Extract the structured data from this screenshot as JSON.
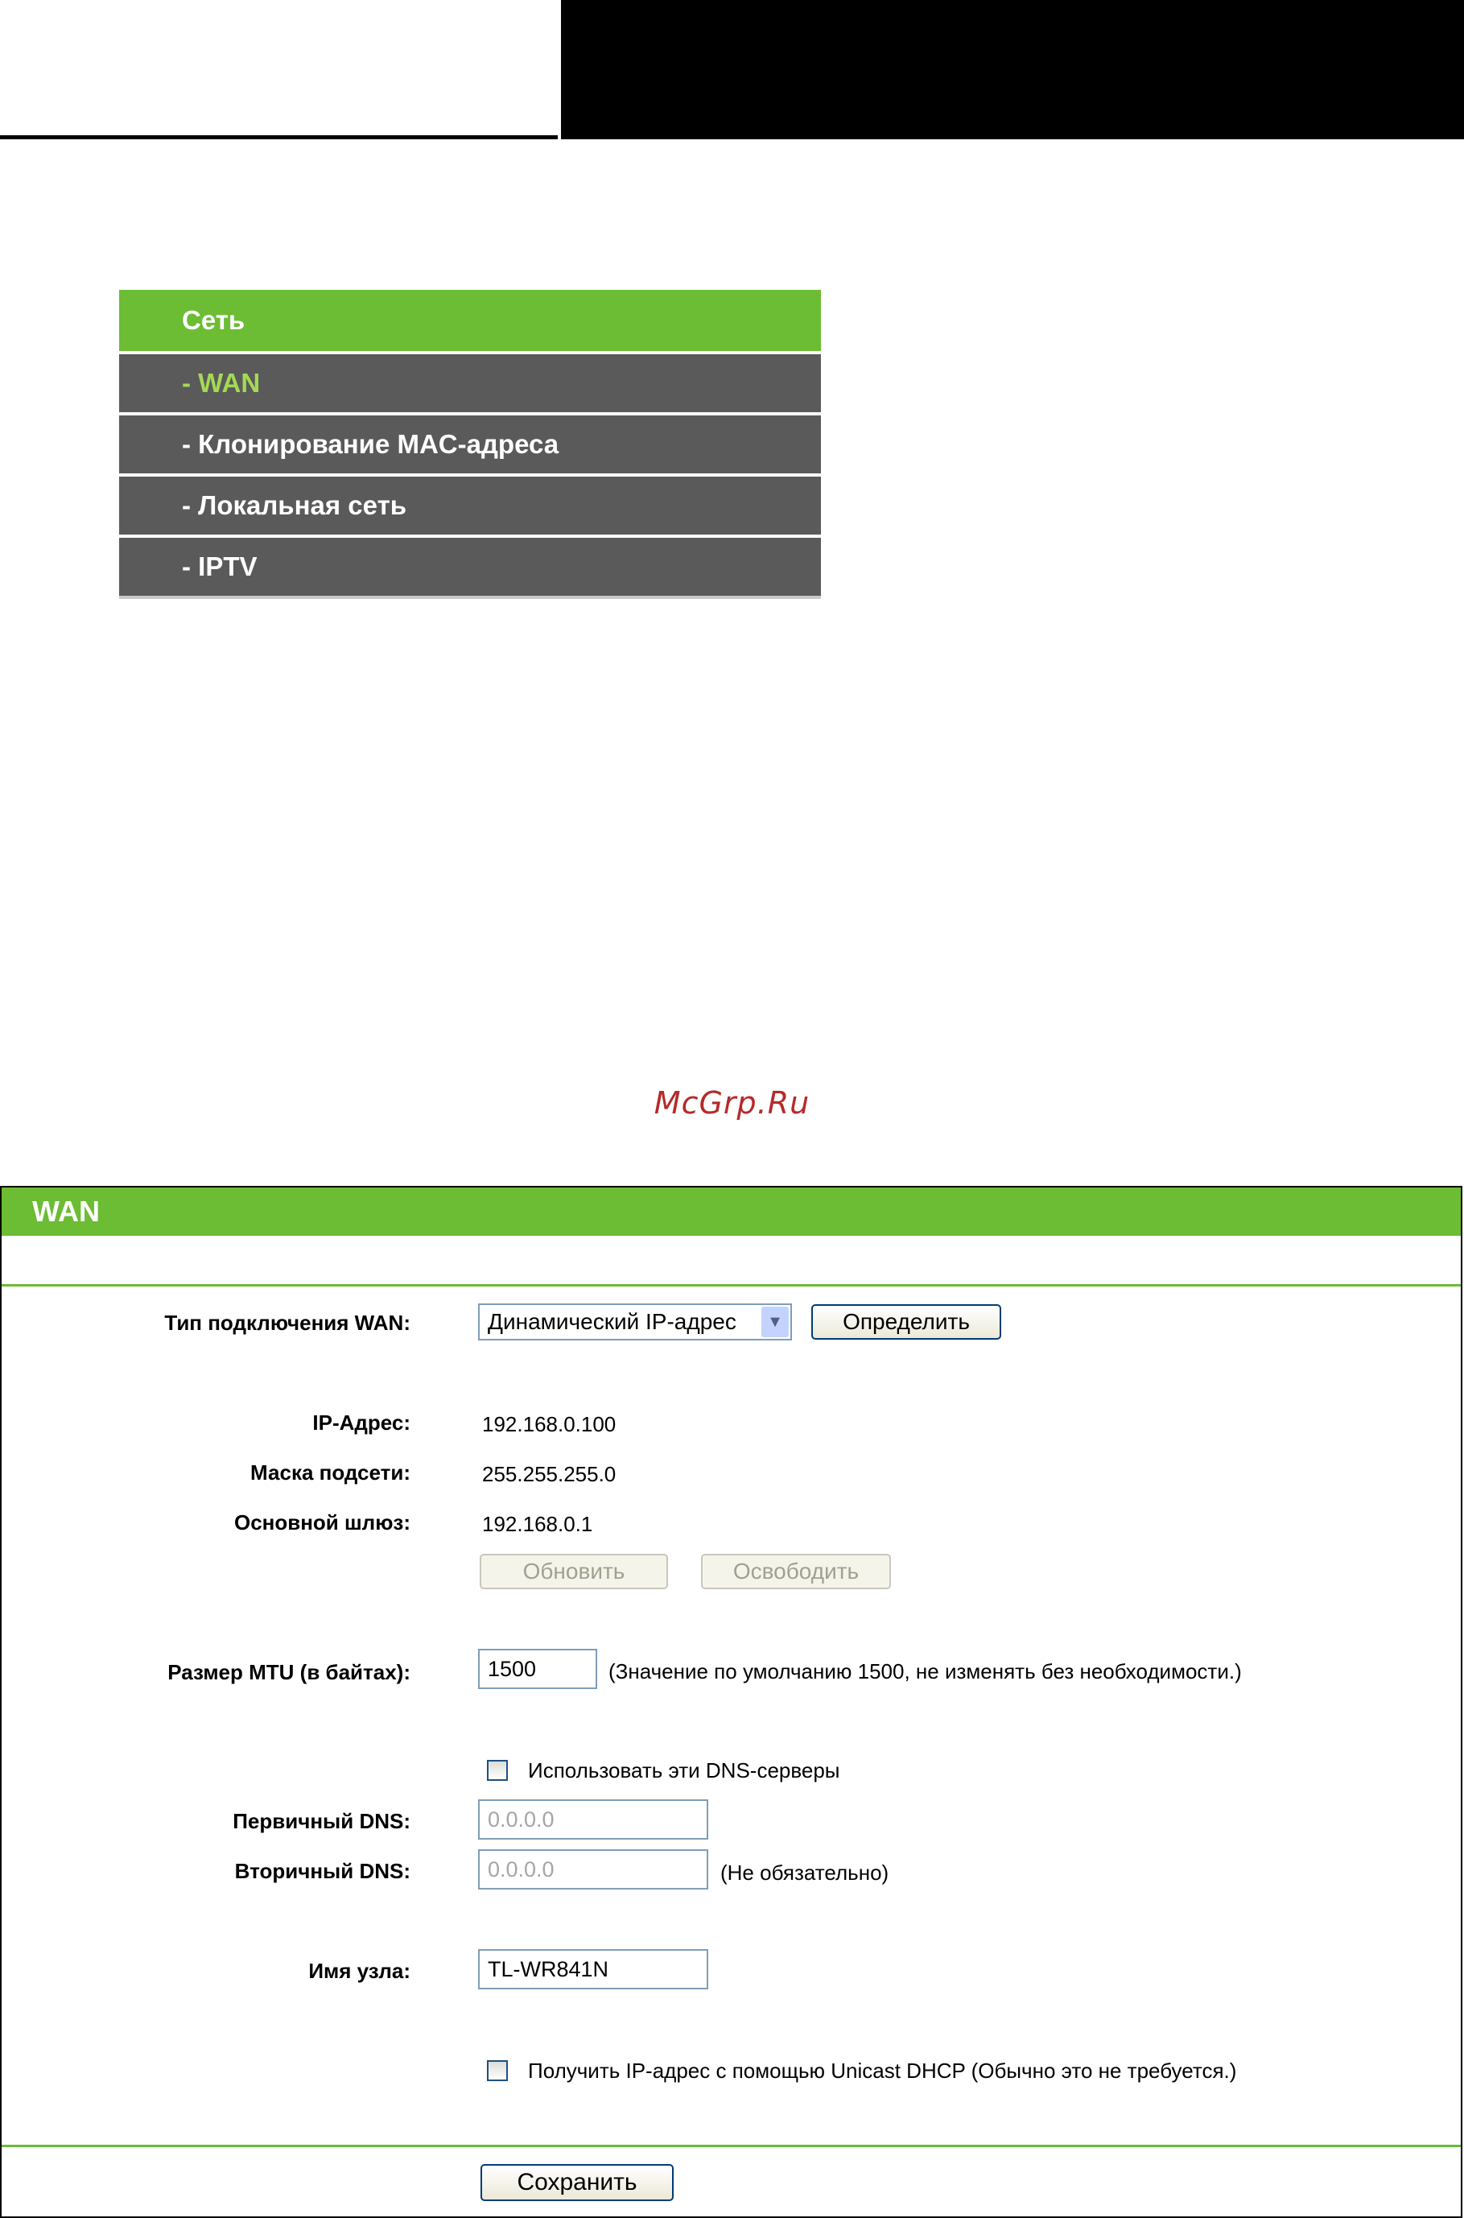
{
  "nav": {
    "header": "Сеть",
    "items": [
      "- WAN",
      "- Клонирование MAC-адреса",
      "- Локальная сеть",
      "- IPTV"
    ]
  },
  "watermark": "McGrp.Ru",
  "panel": {
    "title": "WAN",
    "wan_type_label": "Тип подключения WAN:",
    "wan_type_value": "Динамический IP-адрес",
    "detect_button": "Определить",
    "ip_label": "IP-Адрес:",
    "ip_value": "192.168.0.100",
    "mask_label": "Маска подсети:",
    "mask_value": "255.255.255.0",
    "gateway_label": "Основной шлюз:",
    "gateway_value": "192.168.0.1",
    "renew_button": "Обновить",
    "release_button": "Освободить",
    "mtu_label": "Размер MTU (в байтах):",
    "mtu_value": "1500",
    "mtu_note": "(Значение по умолчанию 1500, не изменять без необходимости.)",
    "use_dns_label": "Использовать эти DNS-серверы",
    "primary_dns_label": "Первичный DNS:",
    "primary_dns_placeholder": "0.0.0.0",
    "secondary_dns_label": "Вторичный DNS:",
    "secondary_dns_placeholder": "0.0.0.0",
    "secondary_dns_note": "(Не обязательно)",
    "hostname_label": "Имя узла:",
    "hostname_value": "TL-WR841N",
    "unicast_label": "Получить IP-адрес с помощью Unicast DHCP (Обычно это не требуется.)",
    "save_button": "Сохранить"
  },
  "colors": {
    "accent": "#6cbc34",
    "menu_bg": "#5a5a5a",
    "active_item": "#a4d955"
  }
}
